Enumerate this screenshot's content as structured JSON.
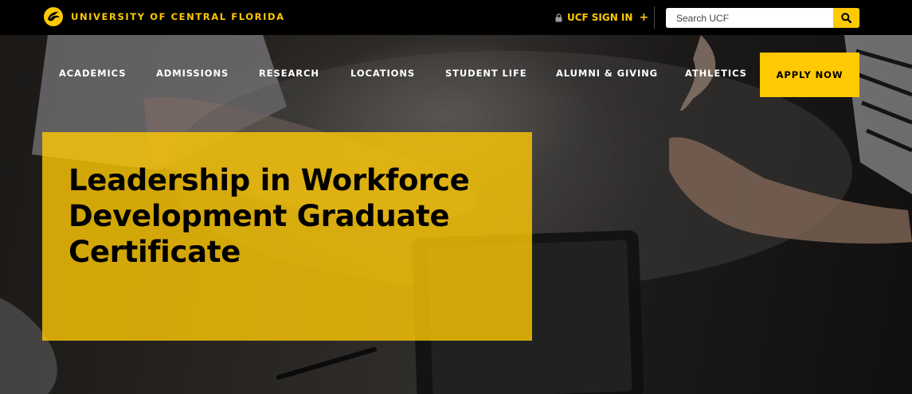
{
  "header": {
    "brand_name": "UNIVERSITY OF CENTRAL FLORIDA",
    "signin_prefix": "UCF",
    "signin_label": "SIGN IN",
    "signin_plus": "+",
    "search_placeholder": "Search UCF"
  },
  "nav": {
    "items": [
      {
        "label": "ACADEMICS"
      },
      {
        "label": "ADMISSIONS"
      },
      {
        "label": "RESEARCH"
      },
      {
        "label": "LOCATIONS"
      },
      {
        "label": "STUDENT LIFE"
      },
      {
        "label": "ALUMNI & GIVING"
      },
      {
        "label": "ATHLETICS"
      }
    ],
    "apply_label": "APPLY NOW"
  },
  "hero": {
    "title": "Leadership in Workforce Development Graduate Certificate"
  },
  "colors": {
    "accent": "#ffc904",
    "topbar": "#000000",
    "text_light": "#ffffff"
  },
  "icons": {
    "logo": "pegasus-logo-icon",
    "lock": "lock-icon",
    "search": "search-icon"
  }
}
